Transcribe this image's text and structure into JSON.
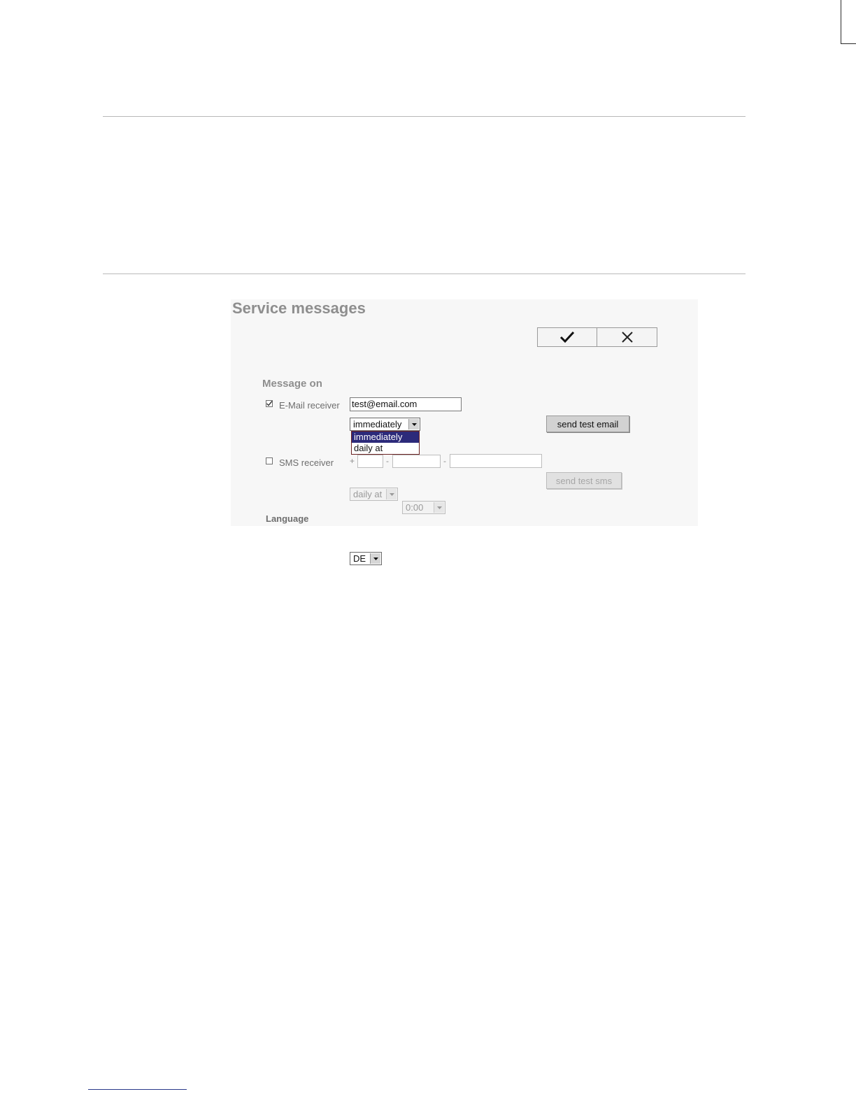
{
  "title": "Service messages",
  "toolbar": {
    "ok_icon": "checkmark-icon",
    "cancel_icon": "close-icon"
  },
  "message_on": {
    "label": "Message on",
    "email": {
      "checked": true,
      "label": "E-Mail receiver",
      "value": "test@email.com",
      "frequency": "immediately",
      "dropdown_options": [
        "immediately",
        "daily at"
      ],
      "test_button": "send test email"
    },
    "sms": {
      "checked": false,
      "label": "SMS receiver",
      "prefix": "+",
      "separator1": "-",
      "separator2": "-",
      "frequency": "daily at",
      "time": "0:00",
      "test_button": "send test sms"
    }
  },
  "language": {
    "label": "Language",
    "value": "DE"
  }
}
